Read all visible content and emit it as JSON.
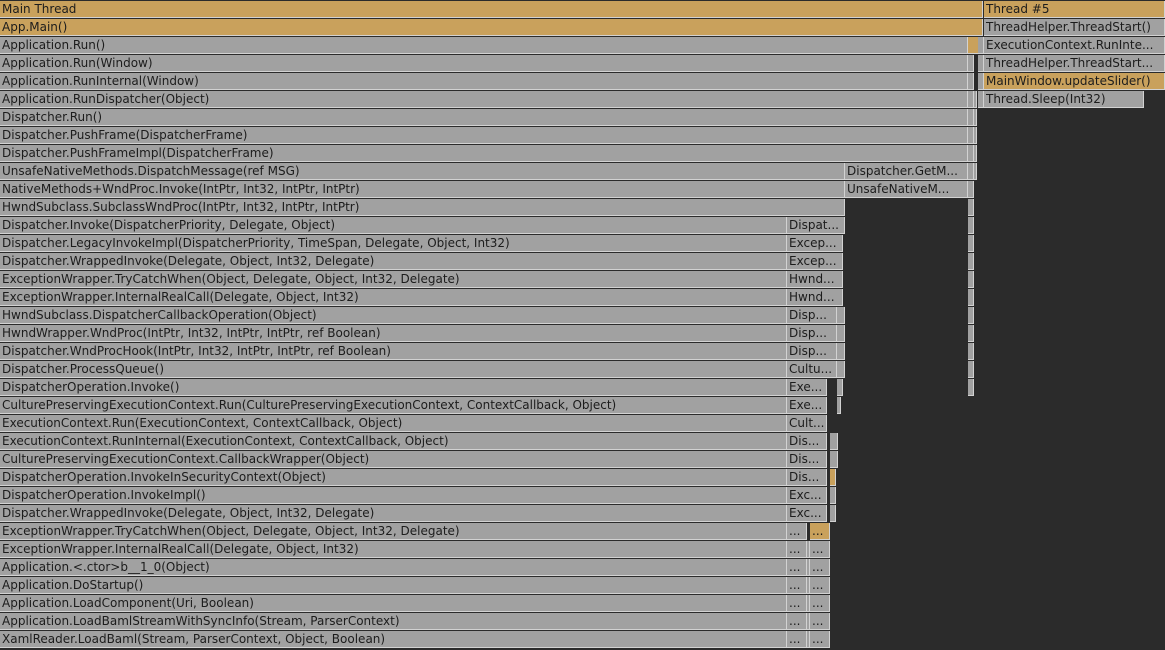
{
  "app": {
    "colors": {
      "background": "#2b2b2b",
      "frame": "#a1a1a1",
      "highlight": "#c9a15c"
    }
  },
  "threads": [
    {
      "label": "Main Thread",
      "highlighted": true
    },
    {
      "label": "Thread #5",
      "highlighted": true
    }
  ],
  "main_stack": [
    "App.Main()",
    "Application.Run()",
    "Application.Run(Window)",
    "Application.RunInternal(Window)",
    "Application.RunDispatcher(Object)",
    "Dispatcher.Run()",
    "Dispatcher.PushFrame(DispatcherFrame)",
    "Dispatcher.PushFrameImpl(DispatcherFrame)",
    "UnsafeNativeMethods.DispatchMessage(ref MSG)",
    "NativeMethods+WndProc.Invoke(IntPtr, Int32, IntPtr, IntPtr)",
    "HwndSubclass.SubclassWndProc(IntPtr, Int32, IntPtr, IntPtr)",
    "Dispatcher.Invoke(DispatcherPriority, Delegate, Object)",
    "Dispatcher.LegacyInvokeImpl(DispatcherPriority, TimeSpan, Delegate, Object, Int32)",
    "Dispatcher.WrappedInvoke(Delegate, Object, Int32, Delegate)",
    "ExceptionWrapper.TryCatchWhen(Object, Delegate, Object, Int32, Delegate)",
    "ExceptionWrapper.InternalRealCall(Delegate, Object, Int32)",
    "HwndSubclass.DispatcherCallbackOperation(Object)",
    "HwndWrapper.WndProc(IntPtr, Int32, IntPtr, IntPtr, ref Boolean)",
    "Dispatcher.WndProcHook(IntPtr, Int32, IntPtr, IntPtr, ref Boolean)",
    "Dispatcher.ProcessQueue()",
    "DispatcherOperation.Invoke()",
    "CulturePreservingExecutionContext.Run(CulturePreservingExecutionContext, ContextCallback, Object)",
    "ExecutionContext.Run(ExecutionContext, ContextCallback, Object)",
    "ExecutionContext.RunInternal(ExecutionContext, ContextCallback, Object)",
    "CulturePreservingExecutionContext.CallbackWrapper(Object)",
    "DispatcherOperation.InvokeInSecurityContext(Object)",
    "DispatcherOperation.InvokeImpl()",
    "Dispatcher.WrappedInvoke(Delegate, Object, Int32, Delegate)",
    "ExceptionWrapper.TryCatchWhen(Object, Delegate, Object, Int32, Delegate)",
    "ExceptionWrapper.InternalRealCall(Delegate, Object, Int32)",
    "Application.<.ctor>b__1_0(Object)",
    "Application.DoStartup()",
    "Application.LoadComponent(Uri, Boolean)",
    "Application.LoadBamlStreamWithSyncInfo(Stream, ParserContext)",
    "XamlReader.LoadBaml(Stream, ParserContext, Object, Boolean)"
  ],
  "col_getmessage": [
    "Dispatcher.GetM...",
    "UnsafeNativeM..."
  ],
  "col_a": [
    "Dispat...",
    "Excep...",
    "Excep...",
    "Hwnd...",
    "Hwnd...",
    "Disp...",
    "Disp...",
    "Disp...",
    "Cultu...",
    "Exe...",
    "Exe...",
    "Cult...",
    "Dis...",
    "Dis...",
    "Dis...",
    "Exc...",
    "Exc...",
    "...",
    "...",
    "...",
    "...",
    "...",
    "...",
    "..."
  ],
  "col_b": [
    "...",
    "...",
    "...",
    "...",
    "...",
    "...",
    "..."
  ],
  "thread5_stack": [
    "ThreadHelper.ThreadStart()",
    "ExecutionContext.RunInte...",
    "ThreadHelper.ThreadStart...",
    "MainWindow.updateSlider()",
    "Thread.Sleep(Int32)"
  ]
}
